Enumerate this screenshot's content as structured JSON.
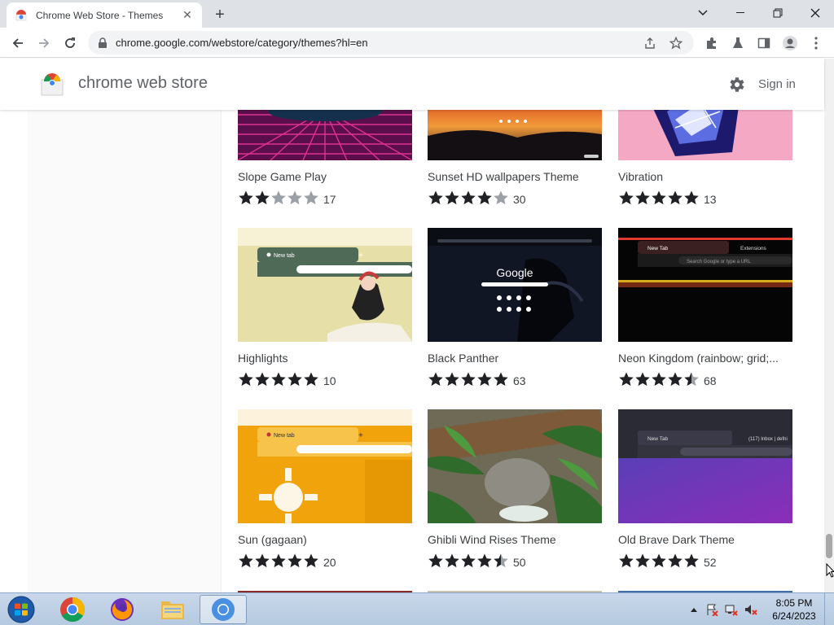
{
  "browser": {
    "tab_title": "Chrome Web Store - Themes",
    "url": "chrome.google.com/webstore/category/themes?hl=en"
  },
  "store": {
    "title": "chrome web store",
    "signin": "Sign in"
  },
  "themes": [
    {
      "name": "Slope Game Play",
      "rating": 2,
      "count": "17"
    },
    {
      "name": "Sunset HD wallpapers Theme",
      "rating": 4,
      "count": "30"
    },
    {
      "name": "Vibration",
      "rating": 5,
      "count": "13"
    },
    {
      "name": "Highlights",
      "rating": 5,
      "count": "10"
    },
    {
      "name": "Black Panther",
      "rating": 5,
      "count": "63"
    },
    {
      "name": "Neon Kingdom (rainbow; grid;...",
      "rating": 4.5,
      "count": "68"
    },
    {
      "name": "Sun (gagaan)",
      "rating": 5,
      "count": "20"
    },
    {
      "name": "Ghibli Wind Rises Theme",
      "rating": 4.5,
      "count": "50"
    },
    {
      "name": "Old Brave Dark Theme",
      "rating": 5,
      "count": "52"
    }
  ],
  "thumbs": {
    "highlights_tab": "New tab",
    "panther_logo": "Google",
    "neon_tab": "New Tab",
    "neon_ext": "Extensions",
    "neon_search": "Search Google or type a URL",
    "sun_tab": "New tab",
    "brave_tab": "New Tab",
    "brave_inbox": "(117) Inbox | defni"
  },
  "taskbar": {
    "time": "8:05 PM",
    "date": "6/24/2023"
  }
}
